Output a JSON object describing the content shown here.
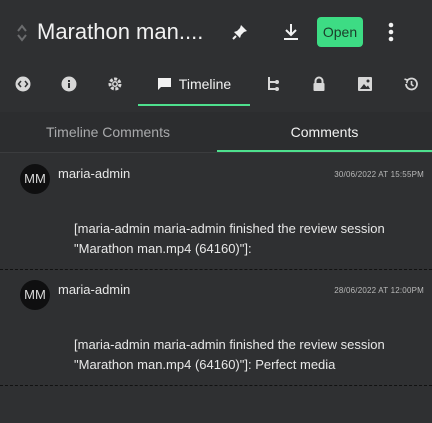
{
  "header": {
    "title": "Marathon man....",
    "open_label": "Open",
    "icons": {
      "drag": "drag-handle-icon",
      "pin": "pin-icon",
      "download": "download-icon",
      "more": "more-vertical-icon"
    },
    "accent_color": "#3ddc84"
  },
  "icon_tabs": [
    {
      "name": "embed-tab",
      "icon": "code-icon"
    },
    {
      "name": "info-tab",
      "icon": "info-icon"
    },
    {
      "name": "settings-tab",
      "icon": "gear-icon"
    },
    {
      "name": "timeline-tab",
      "icon": "comment-icon",
      "label": "Timeline",
      "active": true
    },
    {
      "name": "hierarchy-tab",
      "icon": "hierarchy-icon"
    },
    {
      "name": "lock-tab",
      "icon": "lock-icon"
    },
    {
      "name": "image-tab",
      "icon": "image-icon"
    },
    {
      "name": "history-tab",
      "icon": "history-icon"
    }
  ],
  "sub_tabs": [
    {
      "label": "Timeline Comments",
      "active": false
    },
    {
      "label": "Comments",
      "active": true
    }
  ],
  "comments": [
    {
      "avatar": "MM",
      "author": "maria-admin",
      "date": "30/06/2022 AT 15:55PM",
      "text": "[maria-admin maria-admin finished the review session \"Marathon man.mp4 (64160)\"]:"
    },
    {
      "avatar": "MM",
      "author": "maria-admin",
      "date": "28/06/2022 AT 12:00PM",
      "text": "[maria-admin maria-admin finished the review session \"Marathon man.mp4 (64160)\"]: Perfect media"
    }
  ]
}
